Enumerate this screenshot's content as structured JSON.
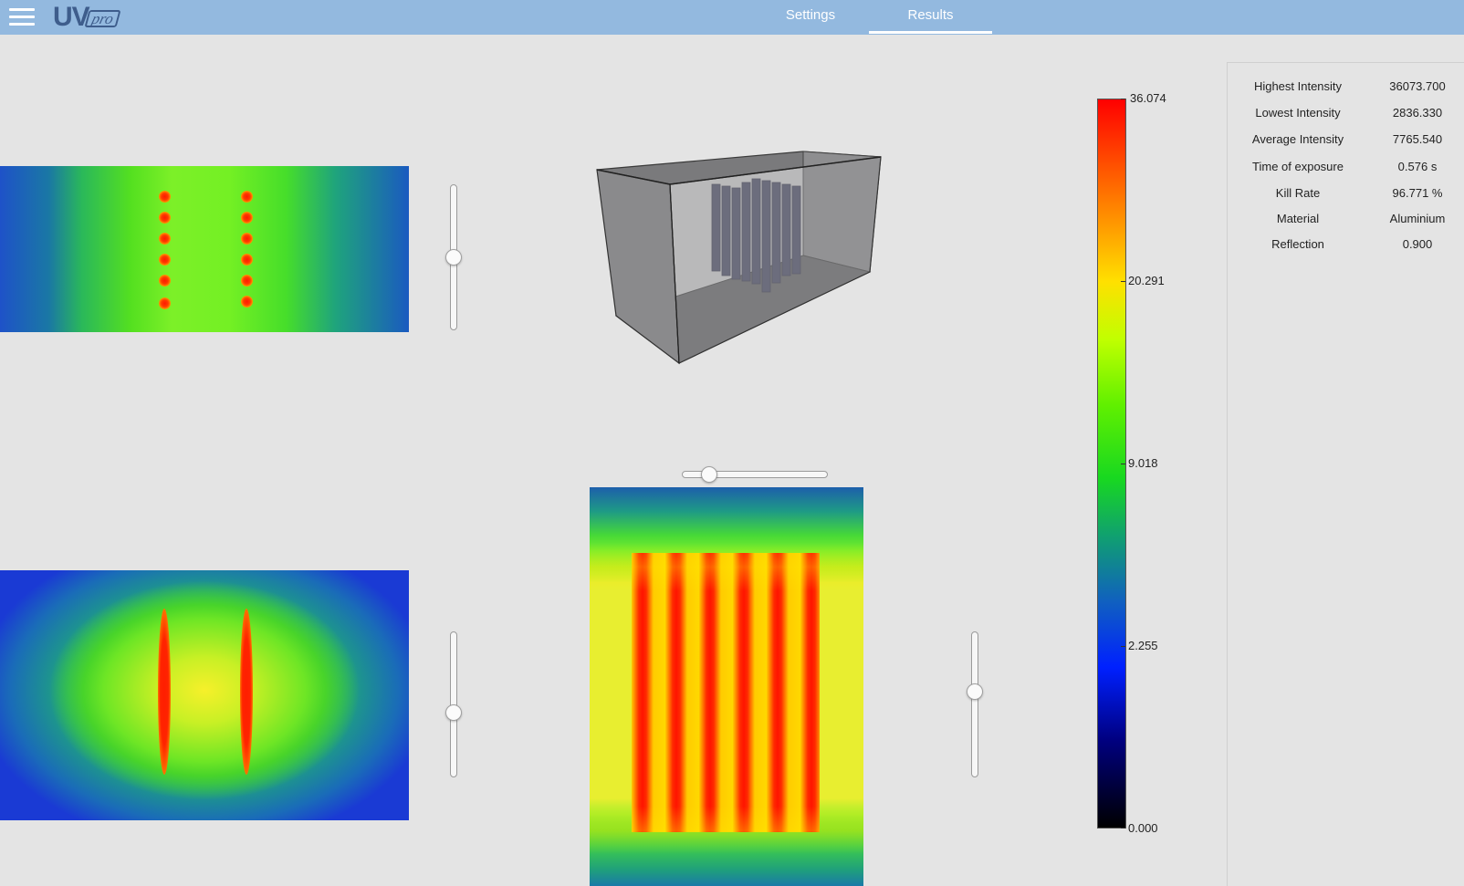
{
  "header": {
    "logo_main": "UV",
    "logo_sub": "pro",
    "tabs": [
      {
        "label": "Settings",
        "active": false
      },
      {
        "label": "Results",
        "active": true
      }
    ]
  },
  "colors": {
    "topbar": "#93b9df",
    "logo": "#3e5d8c",
    "background": "#e4e4e4"
  },
  "icons": {
    "menu": "hamburger-menu-icon"
  },
  "sliders": {
    "top_left_level": 0.5,
    "bottom_left_level": 0.56,
    "bottom_right_level": 0.4,
    "horizontal_level": 0.15
  },
  "legend": {
    "gradient": "red-yellow-green-blue-black",
    "labels": [
      "36.074",
      "20.291",
      "9.018",
      "2.255",
      "0.000"
    ]
  },
  "results": {
    "rows": [
      {
        "label": "Highest Intensity",
        "value": "36073.700"
      },
      {
        "label": "Lowest Intensity",
        "value": "2836.330"
      },
      {
        "label": "Average Intensity",
        "value": "7765.540"
      },
      {
        "label": "Time of exposure",
        "value": "0.576 s"
      },
      {
        "label": "Kill Rate",
        "value": "96.771 %"
      },
      {
        "label": "Material",
        "value": "Aluminium"
      },
      {
        "label": "Reflection",
        "value": "0.900"
      }
    ]
  }
}
